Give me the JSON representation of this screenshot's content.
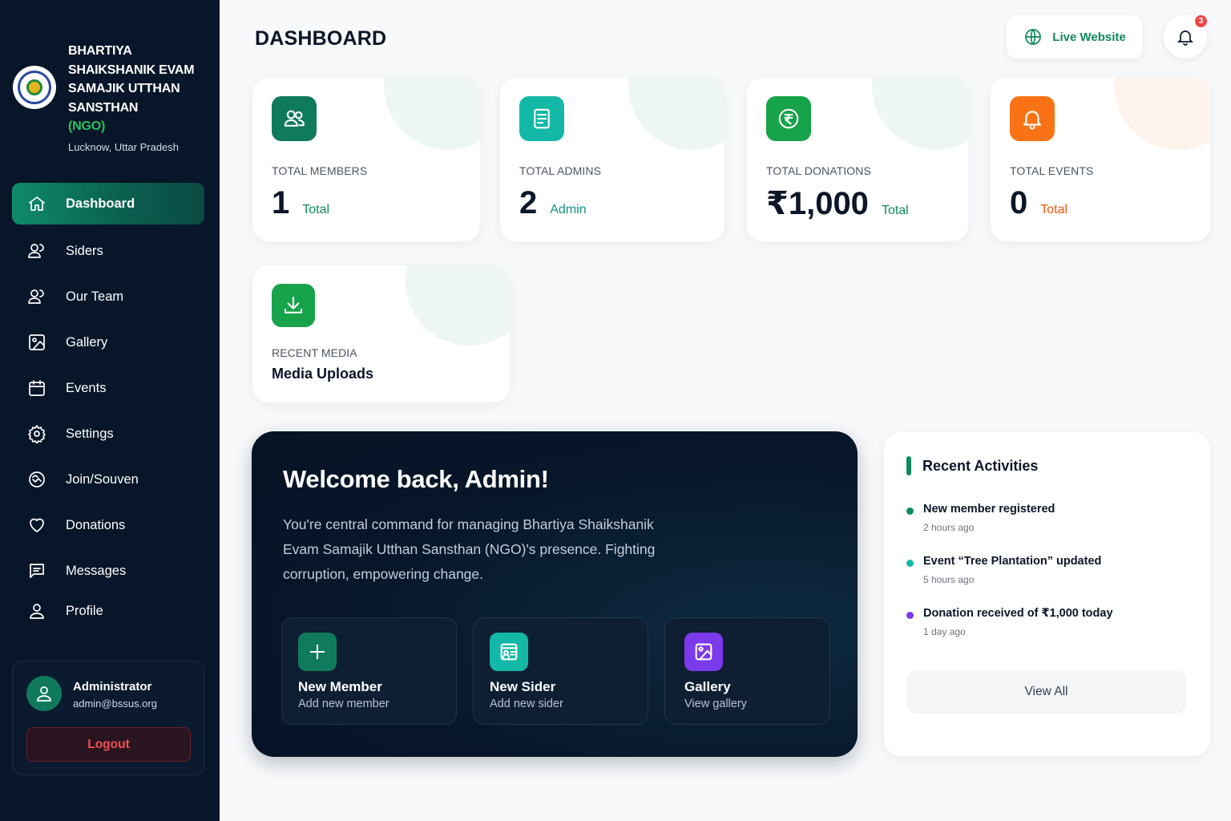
{
  "org": {
    "name": "BHARTIYA SHAIKSHANIK EVAM SAMAJIK UTTHAN SANSTHAN",
    "suffix": "(NGO)",
    "location": "Lucknow, Uttar Pradesh"
  },
  "nav": {
    "items": [
      {
        "label": "Dashboard",
        "icon": "home-icon"
      },
      {
        "label": "Siders",
        "icon": "users-icon"
      },
      {
        "label": "Our Team",
        "icon": "users-icon"
      },
      {
        "label": "Gallery",
        "icon": "image-icon"
      },
      {
        "label": "Events",
        "icon": "calendar-icon"
      },
      {
        "label": "Settings",
        "icon": "gear-icon"
      },
      {
        "label": "Join/Souven",
        "icon": "handshake-icon"
      },
      {
        "label": "Donations",
        "icon": "heart-icon"
      },
      {
        "label": "Messages",
        "icon": "message-icon"
      },
      {
        "label": "Profile",
        "icon": "user-icon"
      }
    ],
    "active": "Dashboard"
  },
  "user": {
    "name": "Administrator",
    "email": "admin@bssus.org",
    "logout_label": "Logout"
  },
  "header": {
    "title": "DASHBOARD",
    "live_label": "Live Website",
    "notification_count": "3"
  },
  "stats": [
    {
      "label": "TOTAL MEMBERS",
      "value": "1",
      "unit": "Total",
      "color": "#0f7a5c",
      "unit_color": "#0f8a5a",
      "icon": "users-icon"
    },
    {
      "label": "TOTAL ADMINS",
      "value": "2",
      "unit": "Admin",
      "color": "#14b8a6",
      "unit_color": "#0d9488",
      "icon": "document-icon"
    },
    {
      "label": "TOTAL DONATIONS",
      "value": "₹1,000",
      "unit": "Total",
      "color": "#16a34a",
      "unit_color": "#0f8a5a",
      "icon": "rupee-icon"
    },
    {
      "label": "TOTAL EVENTS",
      "value": "0",
      "unit": "Total",
      "color": "#f97316",
      "unit_color": "#ea580c",
      "icon": "bell-icon"
    }
  ],
  "media": {
    "label": "RECENT MEDIA",
    "title": "Media Uploads",
    "color": "#16a34a",
    "icon": "download-icon"
  },
  "welcome": {
    "title": "Welcome back, Admin!",
    "text": "You're central command for managing Bhartiya Shaikshanik Evam Samajik Utthan Sansthan (NGO)'s presence. Fighting corruption, empowering change.",
    "actions": [
      {
        "title": "New Member",
        "subtitle": "Add new member",
        "color": "#0f7a5c",
        "icon": "plus-icon"
      },
      {
        "title": "New Sider",
        "subtitle": "Add new sider",
        "color": "#14b8a6",
        "icon": "id-card-icon"
      },
      {
        "title": "Gallery",
        "subtitle": "View gallery",
        "color": "#7c3aed",
        "icon": "image-icon"
      }
    ]
  },
  "activities": {
    "title": "Recent Activities",
    "items": [
      {
        "text": "New member registered",
        "time": "2 hours ago",
        "color": "#0f8a5a"
      },
      {
        "text": "Event “Tree Plantation” updated",
        "time": "5 hours ago",
        "color": "#14b8a6"
      },
      {
        "text": "Donation received of ₹1,000 today",
        "time": "1 day ago",
        "color": "#7c3aed"
      }
    ],
    "view_all_label": "View All"
  }
}
